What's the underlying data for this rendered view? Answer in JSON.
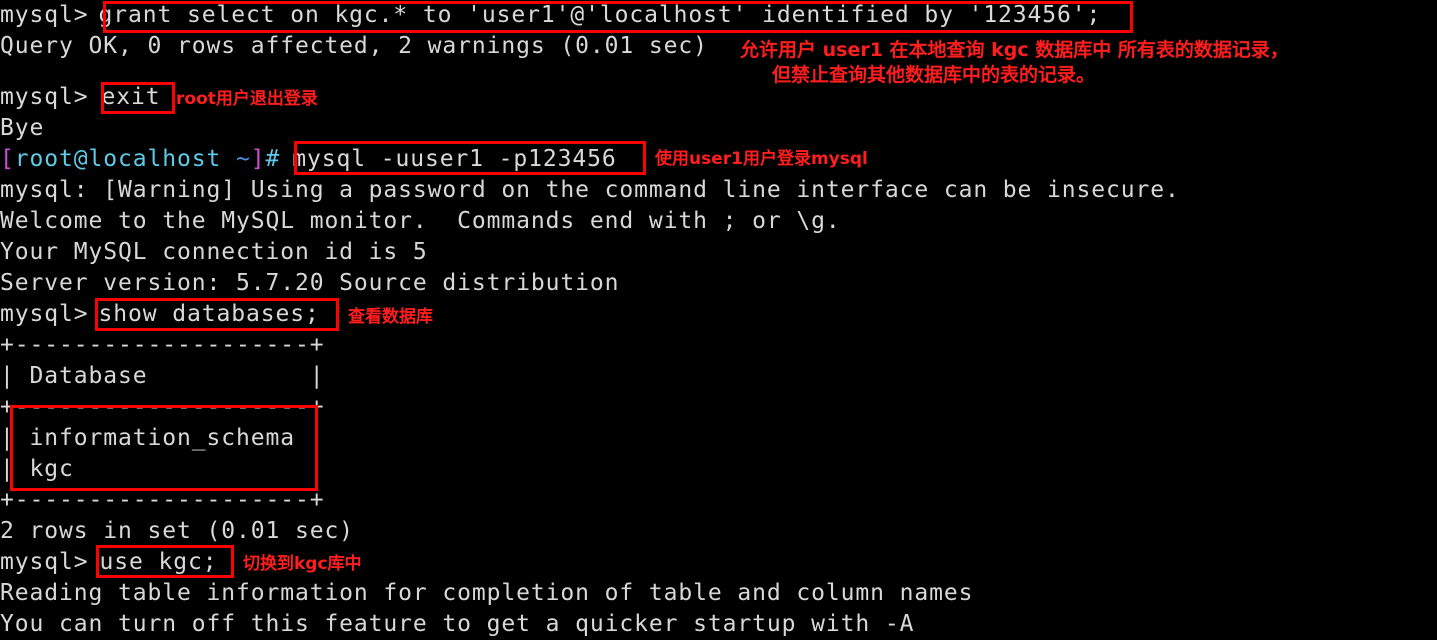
{
  "terminal": {
    "title": "MySQL terminal session",
    "background_color": "#000000",
    "default_text_color": "#d8d8d8",
    "annotation_color": "#ff1d1d",
    "highlight_box_color": "#ff0000",
    "prompt_mysql": "mysql>",
    "prompt_shell_segments": {
      "bracket_open": "[",
      "user_host": "root@localhost",
      "space_tilde": " ~",
      "bracket_close": "]",
      "hash": "#"
    }
  },
  "lines": {
    "l01_prompt": "mysql>",
    "l01_cmd": "grant select on kgc.* to 'user1'@'localhost' identified by '123456';",
    "l02": "Query OK, 0 rows affected, 2 warnings (0.01 sec)",
    "l03_prompt": "mysql>",
    "l03_cmd": "exit",
    "l04": "Bye",
    "l05_cmd": "mysql -uuser1 -p123456",
    "l06": "mysql: [Warning] Using a password on the command line interface can be insecure.",
    "l07": "Welcome to the MySQL monitor.  Commands end with ; or \\g.",
    "l08": "Your MySQL connection id is 5",
    "l09": "Server version: 5.7.20 Source distribution",
    "l10_prompt": "mysql>",
    "l10_cmd": "show databases;",
    "l11_sep_top": "+--------------------+",
    "l12_header": "| Database           |",
    "l13_sep_mid": "+--------------------+",
    "l14_row1": "| information_schema |",
    "l15_row2": "| kgc                |",
    "l16_sep_bot": "+--------------------+",
    "l17": "2 rows in set (0.01 sec)",
    "l18_prompt": "mysql>",
    "l18_cmd": "use kgc;",
    "l19": "Reading table information for completion of table and column names",
    "l20": "You can turn off this feature to get a quicker startup with -A"
  },
  "table": {
    "columns": [
      "Database"
    ],
    "rows": [
      [
        "information_schema"
      ],
      [
        "kgc"
      ]
    ],
    "row_count_text": "2 rows in set (0.01 sec)"
  },
  "annotations": [
    {
      "id": "grant-note",
      "line1": "允许用户 user1 在本地查询 kgc 数据库中 所有表的数据记录，",
      "line2": "但禁止查询其他数据库中的表的记录。"
    },
    {
      "id": "exit-note",
      "text": "root用户退出登录"
    },
    {
      "id": "login-note",
      "text": "使用user1用户登录mysql"
    },
    {
      "id": "showdb-note",
      "text": "查看数据库"
    },
    {
      "id": "usekgc-note",
      "text": "切换到kgc库中"
    }
  ],
  "highlights": [
    {
      "id": "grant-command-box",
      "target": "grant select on kgc.* to 'user1'@'localhost' identified by '123456';"
    },
    {
      "id": "exit-command-box",
      "target": "exit"
    },
    {
      "id": "mysql-login-command-box",
      "target": "mysql -uuser1 -p123456"
    },
    {
      "id": "show-databases-command-box",
      "target": "show databases;"
    },
    {
      "id": "database-list-box",
      "target": "information_schema / kgc"
    },
    {
      "id": "use-kgc-command-box",
      "target": "use kgc;"
    }
  ]
}
